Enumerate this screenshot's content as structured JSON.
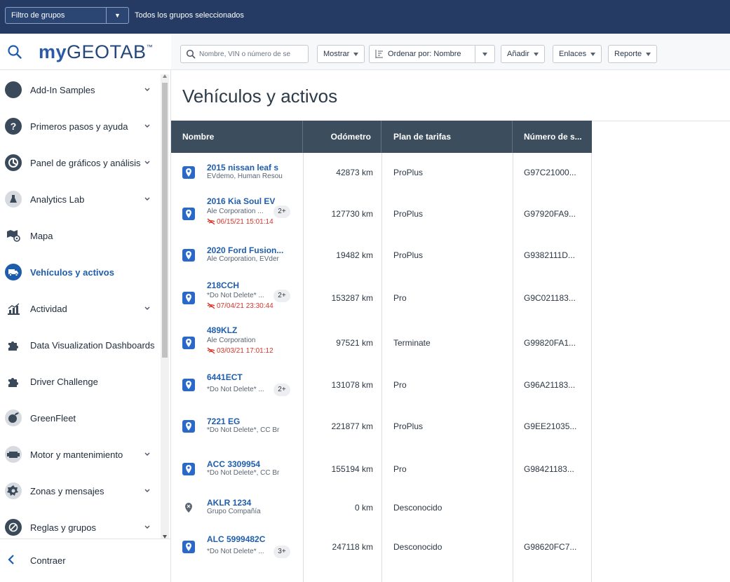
{
  "group_filter": {
    "label": "Filtro de grupos",
    "dropdown_caret": "▼",
    "selection_text": "Todos los grupos seleccionados"
  },
  "brand": {
    "logo_my": "my",
    "logo_geotab": "GEOTAB",
    "logo_tm": "™"
  },
  "sidebar": {
    "items": [
      {
        "label": "Add-In Samples",
        "icon": "circle-icon",
        "expandable": true
      },
      {
        "label": "Primeros pasos y ayuda",
        "icon": "help-icon",
        "expandable": true
      },
      {
        "label": "Panel de gráficos y análisis",
        "icon": "pie-chart-icon",
        "expandable": true
      },
      {
        "label": "Analytics Lab",
        "icon": "flask-icon",
        "expandable": true
      },
      {
        "label": "Mapa",
        "icon": "map-icon",
        "expandable": false
      },
      {
        "label": "Vehículos y activos",
        "icon": "truck-icon",
        "expandable": false,
        "active": true
      },
      {
        "label": "Actividad",
        "icon": "bar-chart-icon",
        "expandable": true
      },
      {
        "label": "Data Visualization Dashboards",
        "icon": "puzzle-icon",
        "expandable": false
      },
      {
        "label": "Driver Challenge",
        "icon": "puzzle-icon",
        "expandable": false
      },
      {
        "label": "GreenFleet",
        "icon": "greenfleet-icon",
        "expandable": false
      },
      {
        "label": "Motor y mantenimiento",
        "icon": "engine-icon",
        "expandable": true
      },
      {
        "label": "Zonas y mensajes",
        "icon": "zones-icon",
        "expandable": true
      },
      {
        "label": "Reglas y grupos",
        "icon": "rules-icon",
        "expandable": true
      }
    ],
    "collapse_label": "Contraer"
  },
  "toolbar": {
    "search_placeholder": "Nombre, VIN o número de se",
    "show_label": "Mostrar",
    "sort_label": "Ordenar por: Nombre",
    "add_label": "Añadir",
    "links_label": "Enlaces",
    "report_label": "Reporte"
  },
  "page_title": "Vehículos y activos",
  "table": {
    "headers": {
      "name": "Nombre",
      "odometer": "Odómetro",
      "rate_plan": "Plan de tarifas",
      "serial": "Número de s..."
    },
    "rows": [
      {
        "name": "2015 nissan leaf s",
        "groups": "EVdemo, Human Resou",
        "badge": "",
        "date": "",
        "odometer": "42873 km",
        "plan": "ProPlus",
        "serial": "G97C21000...",
        "pin": "blue"
      },
      {
        "name": "2016 Kia Soul EV",
        "groups": "Ale Corporation ...",
        "badge": "2+",
        "date": "06/15/21 15:01:14",
        "odometer": "127730 km",
        "plan": "ProPlus",
        "serial": "G97920FA9...",
        "pin": "blue"
      },
      {
        "name": "2020 Ford Fusion...",
        "groups": "Ale Corporation, EVder",
        "badge": "",
        "date": "",
        "odometer": "19482 km",
        "plan": "ProPlus",
        "serial": "G9382111D...",
        "pin": "blue"
      },
      {
        "name": "218CCH",
        "groups": "*Do Not Delete* ...",
        "badge": "2+",
        "date": "07/04/21 23:30:44",
        "odometer": "153287 km",
        "plan": "Pro",
        "serial": "G9C021183...",
        "pin": "blue"
      },
      {
        "name": "489KLZ",
        "groups": "Ale Corporation",
        "badge": "",
        "date": "03/03/21 17:01:12",
        "odometer": "97521 km",
        "plan": "Terminate",
        "serial": "G99820FA1...",
        "pin": "blue"
      },
      {
        "name": "6441ECT",
        "groups": "*Do Not Delete* ...",
        "badge": "2+",
        "date": "",
        "odometer": "131078 km",
        "plan": "Pro",
        "serial": "G96A21183...",
        "pin": "blue"
      },
      {
        "name": "7221 EG",
        "groups": "*Do Not Delete*, CC Br",
        "badge": "",
        "date": "",
        "odometer": "221877 km",
        "plan": "ProPlus",
        "serial": "G9EE21035...",
        "pin": "blue"
      },
      {
        "name": "ACC 3309954",
        "groups": "*Do Not Delete*, CC Br",
        "badge": "",
        "date": "",
        "odometer": "155194 km",
        "plan": "Pro",
        "serial": "G98421183...",
        "pin": "blue"
      },
      {
        "name": "AKLR 1234",
        "groups": "Grupo Compañía",
        "badge": "",
        "date": "",
        "odometer": "0 km",
        "plan": "Desconocido",
        "serial": "",
        "pin": "grey"
      },
      {
        "name": "ALC 5999482C",
        "groups": "*Do Not Delete* ...",
        "badge": "3+",
        "date": "",
        "odometer": "247118 km",
        "plan": "Desconocido",
        "serial": "G98620FC7...",
        "pin": "blue"
      }
    ]
  },
  "colors": {
    "header_bar": "#253b63",
    "table_header": "#3c4d5d",
    "link_blue": "#1f5dae",
    "pin_blue": "#2a69c7",
    "alert_red": "#d8342b"
  }
}
